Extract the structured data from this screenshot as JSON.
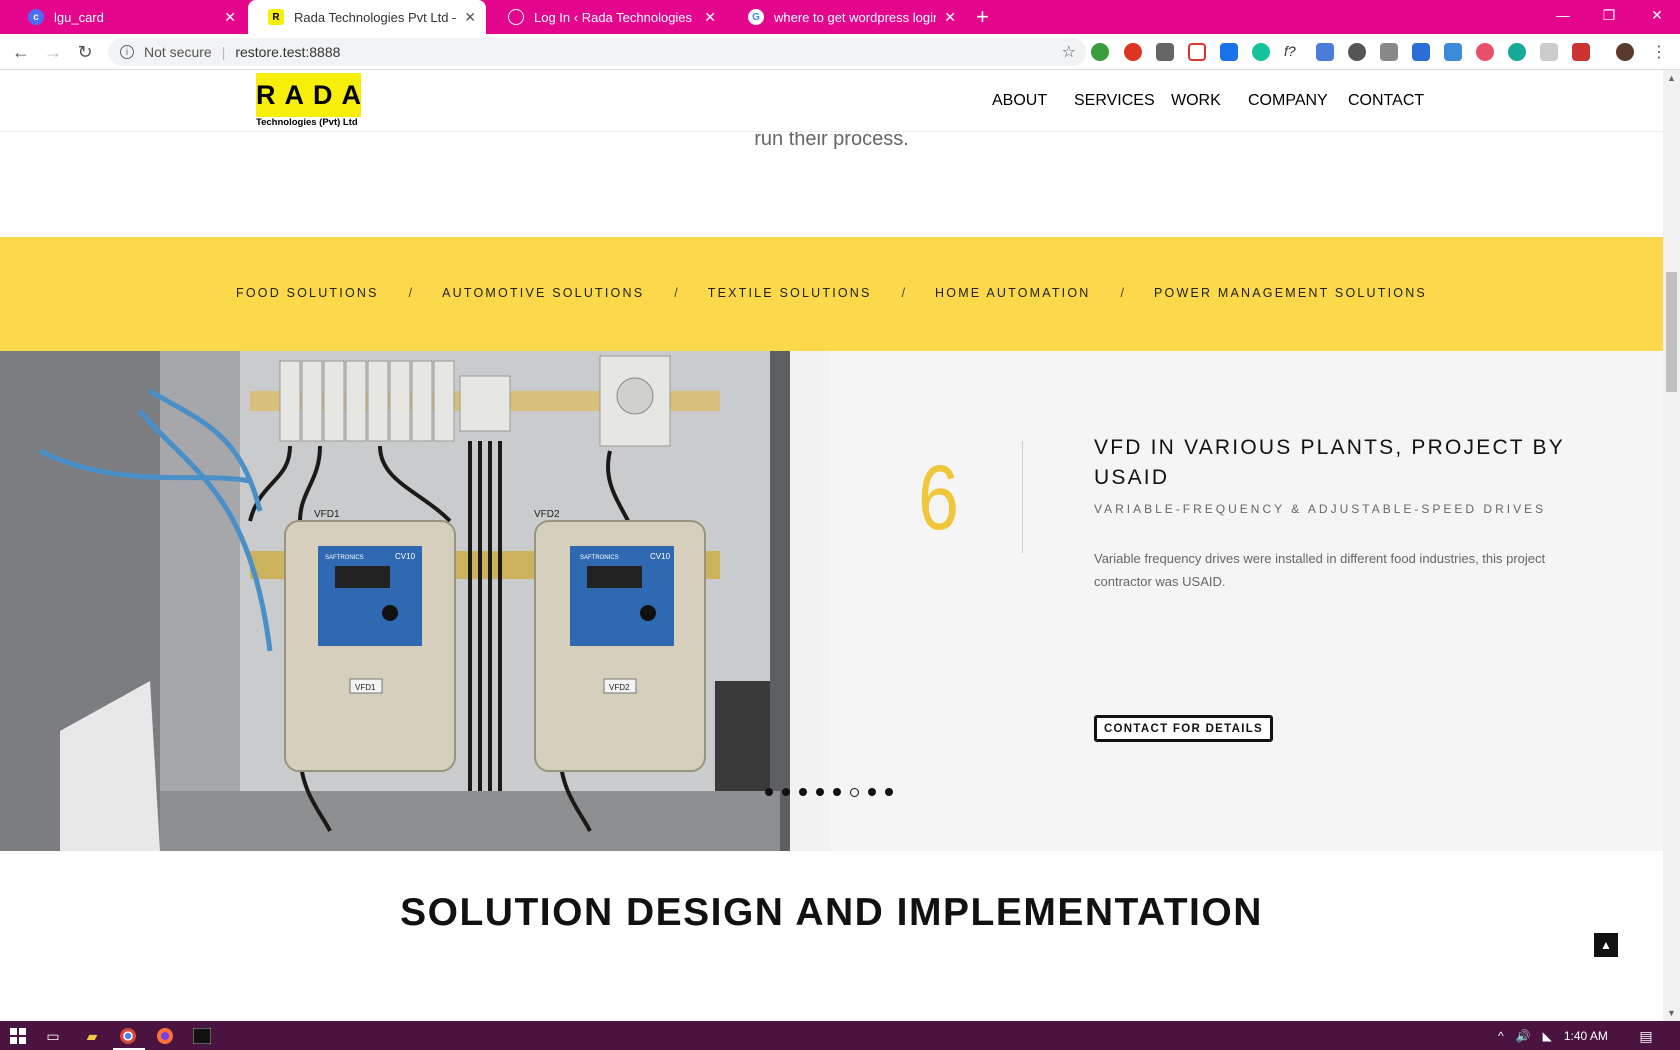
{
  "browser": {
    "tabs": [
      {
        "title": "lgu_card",
        "icon": "c-icon",
        "color": "#4a6cf7"
      },
      {
        "title": "Rada Technologies Pvt Ltd – Auto",
        "icon": "r-icon",
        "color": "#f7ee0a"
      },
      {
        "title": "Log In ‹ Rada Technologies Pvt Lt",
        "icon": "wordpress-icon",
        "color": "#e4068c"
      },
      {
        "title": "where to get wordpress login pa",
        "icon": "google-icon",
        "color": "#ffffff"
      }
    ],
    "new_tab": "+",
    "window_controls": {
      "minimize": "—",
      "restore": "❐",
      "close": "✕"
    },
    "address": {
      "security_label": "Not secure",
      "url": "restore.test:8888"
    },
    "nav": {
      "back": "←",
      "forward": "→",
      "reload": "↻"
    }
  },
  "site": {
    "logo": {
      "mark": "RADA",
      "subtitle": "Technologies (Pvt) Ltd"
    },
    "nav": [
      "ABOUT",
      "SERVICES",
      "WORK",
      "COMPANY",
      "CONTACT"
    ],
    "intro_tail": "run their process.",
    "solutions_nav": [
      "FOOD SOLUTIONS",
      "AUTOMOTIVE SOLUTIONS",
      "TEXTILE SOLUTIONS",
      "HOME AUTOMATION",
      "POWER MANAGEMENT SOLUTIONS"
    ],
    "solutions_separator": "/",
    "project": {
      "number": "6",
      "title": "VFD IN VARIOUS PLANTS, PROJECT BY USAID",
      "subtitle": "VARIABLE-FREQUENCY & ADJUSTABLE-SPEED DRIVES",
      "description": "Variable frequency drives were installed in different food industries, this project contractor was USAID.",
      "cta": "CONTACT FOR DETAILS"
    },
    "photo_labels": {
      "drive1_top": "VFD1",
      "drive2_top": "VFD2",
      "drive1_tag": "VFD1",
      "drive2_tag": "VFD2",
      "brand": "SAFTRONICS",
      "model": "CV10"
    },
    "slider": {
      "total_slides": 8,
      "active_slide": 6
    },
    "section_title": "SOLUTION DESIGN AND IMPLEMENTATION",
    "to_top": "▲"
  },
  "taskbar": {
    "time": "1:40 AM"
  },
  "colors": {
    "tabbar": "#e4068c",
    "accent_yellow": "#fcd94a",
    "number_yellow": "#f0c73a",
    "taskbar": "#4b1440"
  }
}
